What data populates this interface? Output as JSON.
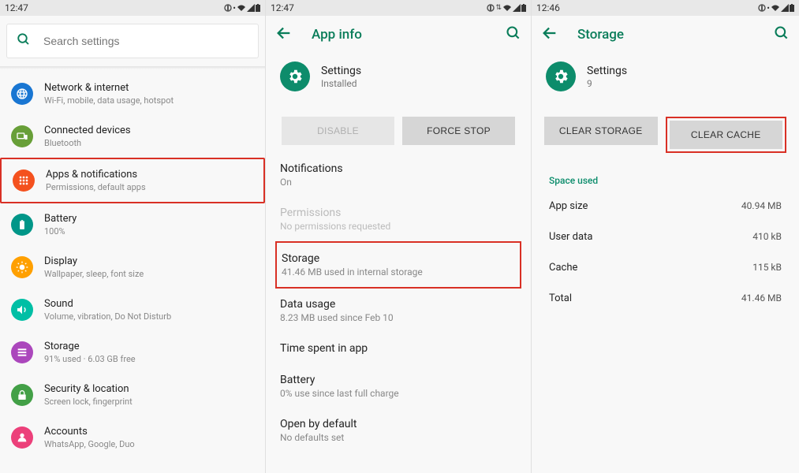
{
  "status": {
    "time1": "12:47",
    "time2": "12:47",
    "time3": "12:46"
  },
  "pane1": {
    "search_placeholder": "Search settings",
    "items": [
      {
        "title": "Network & internet",
        "sub": "Wi-Fi, mobile, data usage, hotspot",
        "icon": "globe",
        "bg": "#1976d2"
      },
      {
        "title": "Connected devices",
        "sub": "Bluetooth",
        "icon": "devices",
        "bg": "#689f38"
      },
      {
        "title": "Apps & notifications",
        "sub": "Permissions, default apps",
        "icon": "apps",
        "bg": "#f4511e",
        "highlight": true
      },
      {
        "title": "Battery",
        "sub": "100%",
        "icon": "battery",
        "bg": "#009688"
      },
      {
        "title": "Display",
        "sub": "Wallpaper, sleep, font size",
        "icon": "display",
        "bg": "#ffa000"
      },
      {
        "title": "Sound",
        "sub": "Volume, vibration, Do Not Disturb",
        "icon": "sound",
        "bg": "#00bfa5"
      },
      {
        "title": "Storage",
        "sub": "91% used · 6.03 GB free",
        "icon": "storage",
        "bg": "#ab47bc"
      },
      {
        "title": "Security & location",
        "sub": "Screen lock, fingerprint",
        "icon": "lock",
        "bg": "#43a047"
      },
      {
        "title": "Accounts",
        "sub": "WhatsApp, Google, Duo",
        "icon": "accounts",
        "bg": "#ec407a"
      }
    ]
  },
  "pane2": {
    "appbar_title": "App info",
    "app_name": "Settings",
    "app_status": "Installed",
    "btn_disable": "DISABLE",
    "btn_force_stop": "FORCE STOP",
    "rows": [
      {
        "title": "Notifications",
        "sub": "On"
      },
      {
        "title": "Permissions",
        "sub": "No permissions requested",
        "muted": true
      },
      {
        "title": "Storage",
        "sub": "41.46 MB used in internal storage",
        "highlight": true
      },
      {
        "title": "Data usage",
        "sub": "8.23 MB used since Feb 10"
      },
      {
        "title": "Time spent in app",
        "sub": ""
      },
      {
        "title": "Battery",
        "sub": "0% use since last full charge"
      },
      {
        "title": "Open by default",
        "sub": "No defaults set"
      }
    ]
  },
  "pane3": {
    "appbar_title": "Storage",
    "app_name": "Settings",
    "app_status": "9",
    "btn_clear_storage": "CLEAR STORAGE",
    "btn_clear_cache": "CLEAR CACHE",
    "section_label": "Space used",
    "usage": [
      {
        "label": "App size",
        "value": "40.94 MB"
      },
      {
        "label": "User data",
        "value": "410 kB"
      },
      {
        "label": "Cache",
        "value": "115 kB"
      },
      {
        "label": "Total",
        "value": "41.46 MB"
      }
    ]
  }
}
